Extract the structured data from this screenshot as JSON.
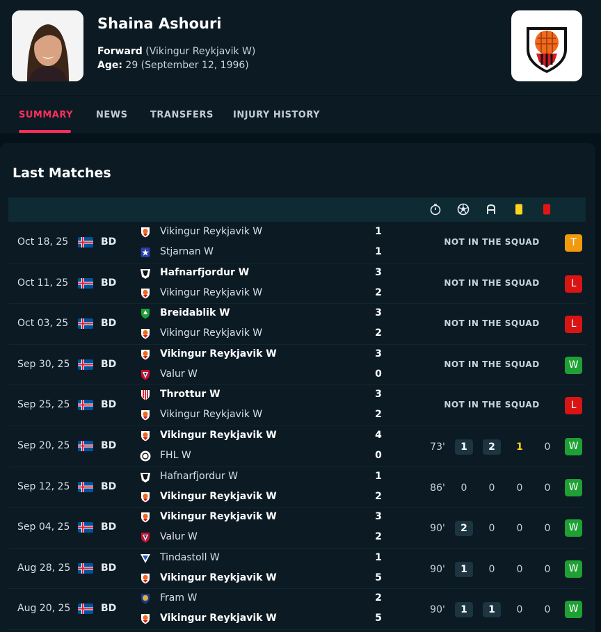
{
  "player": {
    "name": "Shaina Ashouri",
    "position_label": "Forward",
    "club": "(Vikingur Reykjavik W)",
    "age_label": "Age:",
    "age": "29 (September 12, 1996)"
  },
  "tabs": [
    {
      "label": "SUMMARY",
      "active": true
    },
    {
      "label": "NEWS",
      "active": false
    },
    {
      "label": "TRANSFERS",
      "active": false
    },
    {
      "label": "INJURY HISTORY",
      "active": false
    }
  ],
  "section_title": "Last Matches",
  "header_icons": [
    "stopwatch-icon",
    "ball-icon",
    "assist-icon",
    "yellow-card-icon",
    "red-card-icon"
  ],
  "colors": {
    "accent": "#ff2e5b",
    "win": "#1fa035",
    "loss": "#d91414",
    "tie": "#f29a0c",
    "yellow": "#ffd21f"
  },
  "matches": [
    {
      "date": "Oct 18, 25",
      "comp": "BD",
      "home": "Vikingur Reykjavik W",
      "home_score": "1",
      "away": "Stjarnan W",
      "away_score": "1",
      "bold": "none",
      "status": "NOT IN THE SQUAD",
      "result": "T",
      "home_logo": "vikingur",
      "away_logo": "stjarnan"
    },
    {
      "date": "Oct 11, 25",
      "comp": "BD",
      "home": "Hafnarfjordur W",
      "home_score": "3",
      "away": "Vikingur Reykjavik W",
      "away_score": "2",
      "bold": "home",
      "status": "NOT IN THE SQUAD",
      "result": "L",
      "home_logo": "hafnarfjordur",
      "away_logo": "vikingur"
    },
    {
      "date": "Oct 03, 25",
      "comp": "BD",
      "home": "Breidablik W",
      "home_score": "3",
      "away": "Vikingur Reykjavik W",
      "away_score": "2",
      "bold": "home",
      "status": "NOT IN THE SQUAD",
      "result": "L",
      "home_logo": "breidablik",
      "away_logo": "vikingur"
    },
    {
      "date": "Sep 30, 25",
      "comp": "BD",
      "home": "Vikingur Reykjavik W",
      "home_score": "3",
      "away": "Valur W",
      "away_score": "0",
      "bold": "home",
      "status": "NOT IN THE SQUAD",
      "result": "W",
      "home_logo": "vikingur",
      "away_logo": "valur"
    },
    {
      "date": "Sep 25, 25",
      "comp": "BD",
      "home": "Throttur W",
      "home_score": "3",
      "away": "Vikingur Reykjavik W",
      "away_score": "2",
      "bold": "home",
      "status": "NOT IN THE SQUAD",
      "result": "L",
      "home_logo": "throttur",
      "away_logo": "vikingur"
    },
    {
      "date": "Sep 20, 25",
      "comp": "BD",
      "home": "Vikingur Reykjavik W",
      "home_score": "4",
      "away": "FHL W",
      "away_score": "0",
      "bold": "home",
      "status": "",
      "minutes": "73'",
      "goals": "1",
      "assists": "2",
      "yellow": "1",
      "red": "0",
      "result": "W",
      "home_logo": "vikingur",
      "away_logo": "fhl"
    },
    {
      "date": "Sep 12, 25",
      "comp": "BD",
      "home": "Hafnarfjordur W",
      "home_score": "1",
      "away": "Vikingur Reykjavik W",
      "away_score": "2",
      "bold": "away",
      "status": "",
      "minutes": "86'",
      "goals": "0",
      "assists": "0",
      "yellow": "0",
      "red": "0",
      "result": "W",
      "home_logo": "hafnarfjordur",
      "away_logo": "vikingur"
    },
    {
      "date": "Sep 04, 25",
      "comp": "BD",
      "home": "Vikingur Reykjavik W",
      "home_score": "3",
      "away": "Valur W",
      "away_score": "2",
      "bold": "home",
      "status": "",
      "minutes": "90'",
      "goals": "2",
      "assists": "0",
      "yellow": "0",
      "red": "0",
      "result": "W",
      "home_logo": "vikingur",
      "away_logo": "valur"
    },
    {
      "date": "Aug 28, 25",
      "comp": "BD",
      "home": "Tindastoll W",
      "home_score": "1",
      "away": "Vikingur Reykjavik W",
      "away_score": "5",
      "bold": "away",
      "status": "",
      "minutes": "90'",
      "goals": "1",
      "assists": "0",
      "yellow": "0",
      "red": "0",
      "result": "W",
      "home_logo": "tindastoll",
      "away_logo": "vikingur"
    },
    {
      "date": "Aug 20, 25",
      "comp": "BD",
      "home": "Fram W",
      "home_score": "2",
      "away": "Vikingur Reykjavik W",
      "away_score": "5",
      "bold": "away",
      "status": "",
      "minutes": "90'",
      "goals": "1",
      "assists": "1",
      "yellow": "0",
      "red": "0",
      "result": "W",
      "home_logo": "fram",
      "away_logo": "vikingur"
    }
  ]
}
